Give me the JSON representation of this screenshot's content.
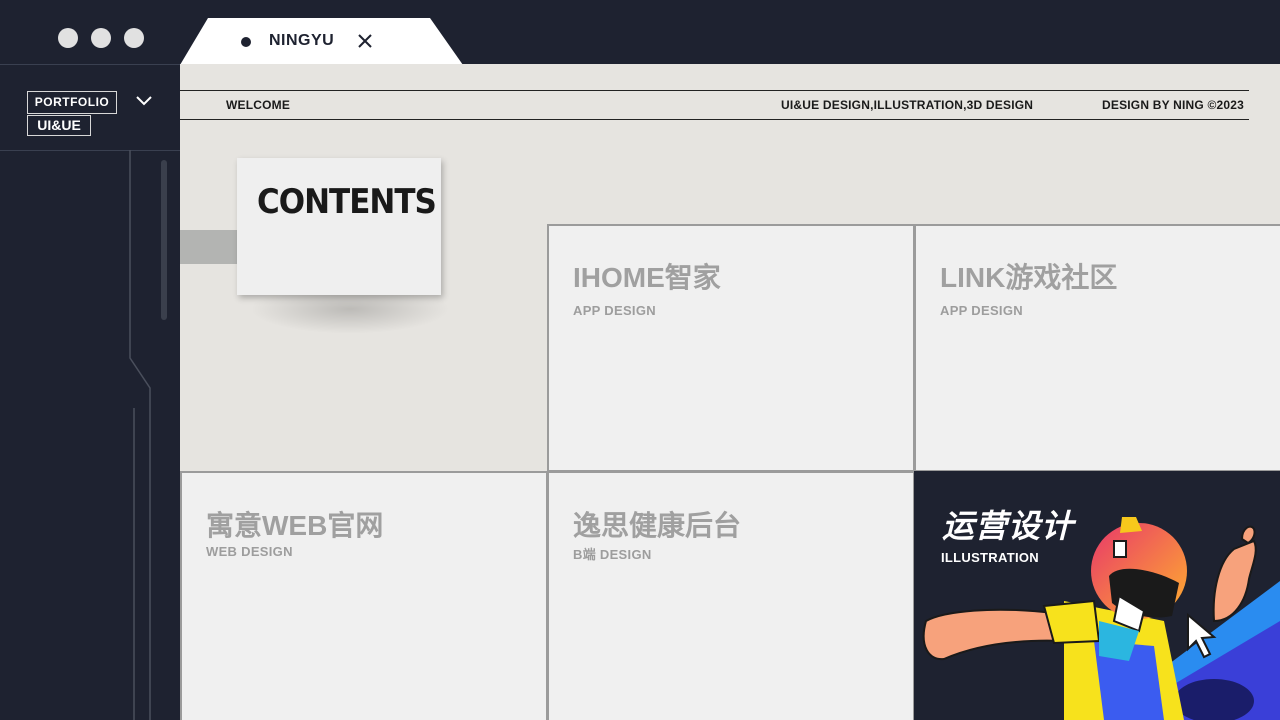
{
  "window": {
    "controls": [
      "close",
      "minimize",
      "maximize"
    ]
  },
  "tab": {
    "label": "NINGYU",
    "close_icon": "close-icon"
  },
  "sidebar": {
    "logo_line1": "PORTFOLIO",
    "logo_line2": "UI&UE",
    "toggle_icon": "chevron-down-icon"
  },
  "header": {
    "welcome": "WELCOME",
    "services": "UI&UE DESIGN,ILLUSTRATION,3D DESIGN",
    "credit": "DESIGN BY NING ©2023"
  },
  "contents_card": {
    "title": "CONTENTS"
  },
  "projects": [
    {
      "title": "IHOME智家",
      "subtitle": "APP DESIGN"
    },
    {
      "title": "LINK游戏社区",
      "subtitle": "APP DESIGN"
    },
    {
      "title": "寓意WEB官网",
      "subtitle": "WEB DESIGN"
    },
    {
      "title": "逸思健康后台",
      "subtitle": "B端 DESIGN"
    },
    {
      "title": "运营设计",
      "subtitle": "ILLUSTRATION"
    }
  ],
  "colors": {
    "background_dark": "#1e2230",
    "main_background": "#e6e4e0",
    "tile_background": "#f0f0f0",
    "tile_text": "#a0a0a0"
  }
}
